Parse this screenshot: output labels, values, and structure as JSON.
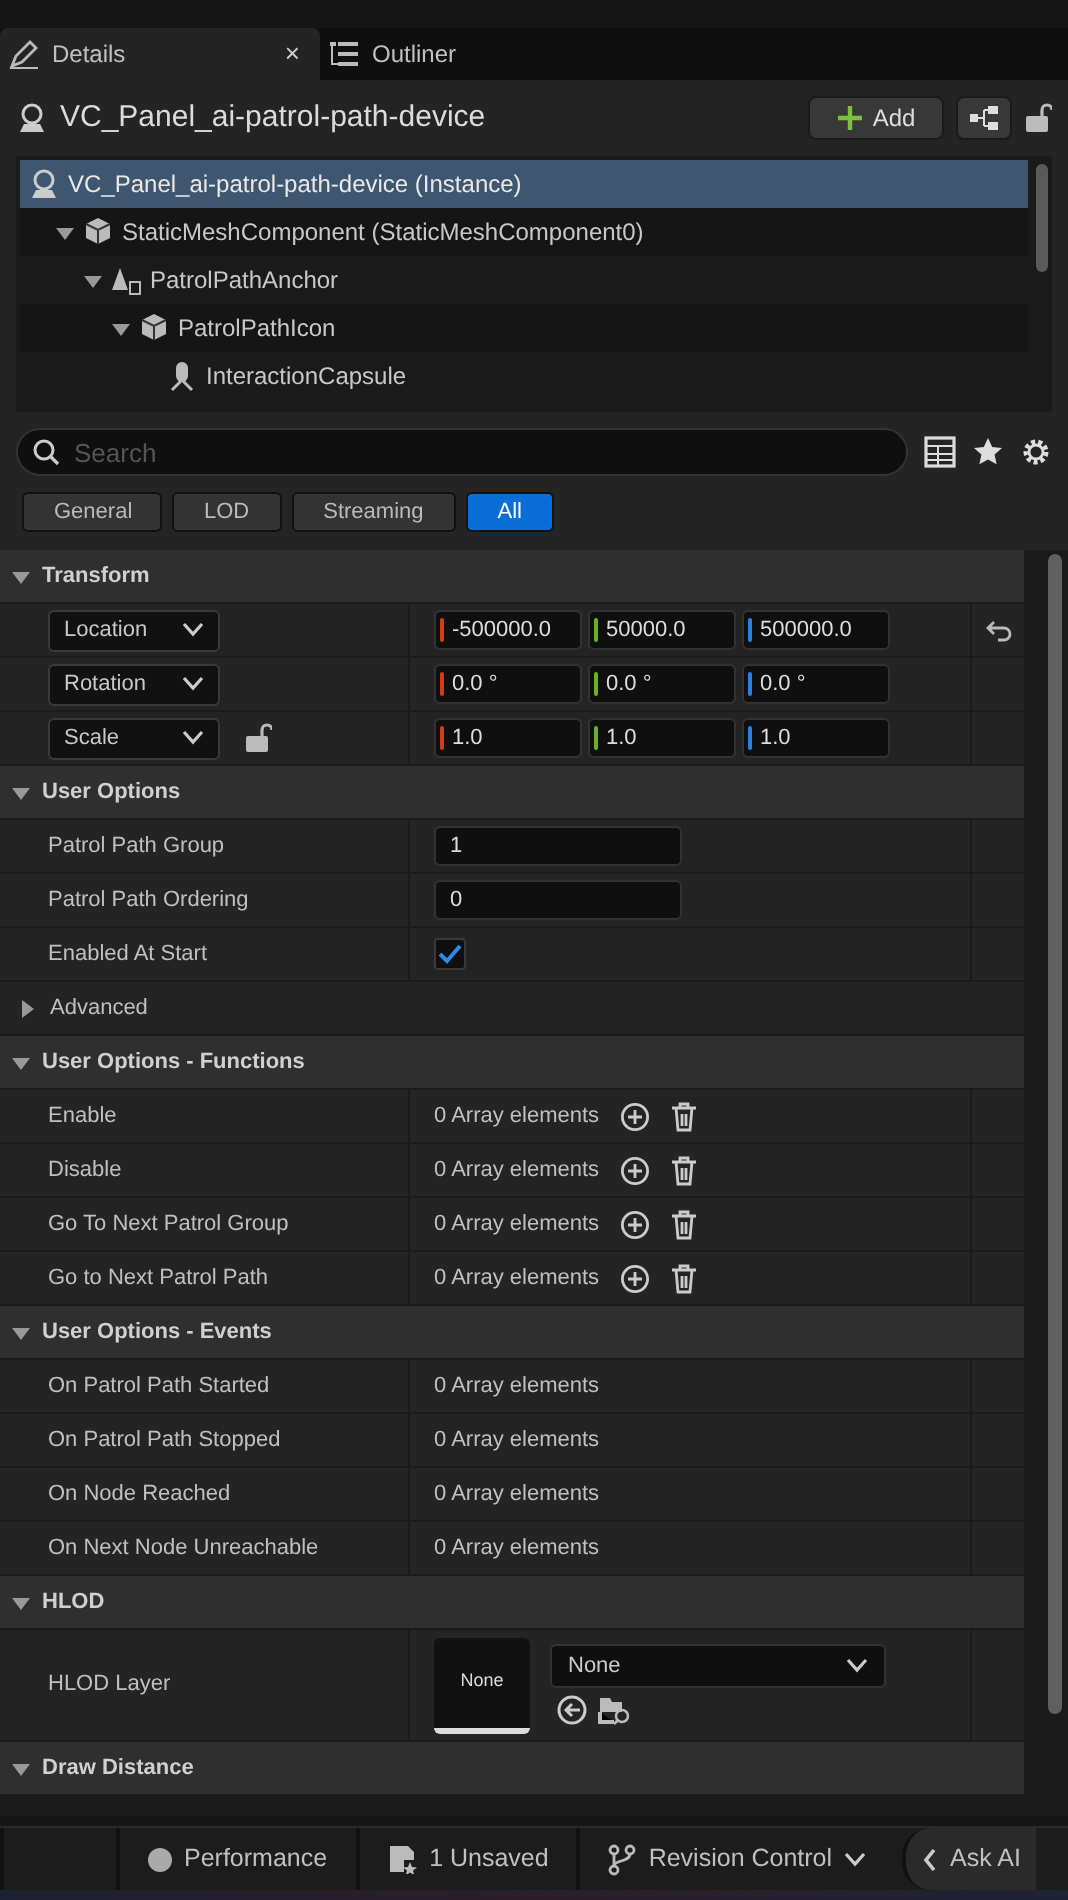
{
  "tabs": [
    {
      "label": "Details",
      "selected": true,
      "close": "×"
    },
    {
      "label": "Outliner",
      "selected": false
    }
  ],
  "header": {
    "title": "VC_Panel_ai-patrol-path-device",
    "add_button": "Add"
  },
  "tree": [
    {
      "label": "VC_Panel_ai-patrol-path-device (Instance)",
      "kind": "actor",
      "selected": true,
      "children": [
        {
          "label": "StaticMeshComponent (StaticMeshComponent0)",
          "kind": "mesh",
          "selected": false,
          "expanded": true,
          "children": [
            {
              "label": "PatrolPathAnchor",
              "kind": "anchor",
              "selected": false,
              "expanded": true,
              "children": [
                {
                  "label": "PatrolPathIcon",
                  "kind": "mesh",
                  "selected": false,
                  "expanded": true,
                  "children": [
                    {
                      "label": "InteractionCapsule",
                      "kind": "capsule",
                      "selected": false
                    }
                  ]
                }
              ]
            }
          ]
        }
      ]
    }
  ],
  "search": {
    "placeholder": "Search"
  },
  "filters": [
    {
      "label": "General",
      "selected": false
    },
    {
      "label": "LOD",
      "selected": false
    },
    {
      "label": "Streaming",
      "selected": false
    },
    {
      "label": "All",
      "selected": true
    }
  ],
  "sections": [
    {
      "title": "Transform",
      "expanded": true,
      "rows": [
        {
          "kind": "vector",
          "label": "Location",
          "values": [
            "-500000.0",
            "50000.0",
            "500000.0"
          ],
          "reset": true,
          "lockable": false
        },
        {
          "kind": "vector",
          "label": "Rotation",
          "values": [
            "0.0 °",
            "0.0 °",
            "0.0 °"
          ],
          "reset": false,
          "lockable": false
        },
        {
          "kind": "vector",
          "label": "Scale",
          "values": [
            "1.0",
            "1.0",
            "1.0"
          ],
          "reset": false,
          "lockable": true
        }
      ]
    },
    {
      "title": "User Options",
      "expanded": true,
      "rows": [
        {
          "kind": "number",
          "label": "Patrol Path Group",
          "value": "1"
        },
        {
          "kind": "number",
          "label": "Patrol Path Ordering",
          "value": "0"
        },
        {
          "kind": "checkbox",
          "label": "Enabled At Start",
          "checked": true
        },
        {
          "kind": "group",
          "label": "Advanced",
          "expanded": false
        }
      ]
    },
    {
      "title": "User Options - Functions",
      "expanded": true,
      "rows": [
        {
          "kind": "array",
          "label": "Enable",
          "value": "0 Array elements",
          "editable": true
        },
        {
          "kind": "array",
          "label": "Disable",
          "value": "0 Array elements",
          "editable": true
        },
        {
          "kind": "array",
          "label": "Go To Next Patrol Group",
          "value": "0 Array elements",
          "editable": true
        },
        {
          "kind": "array",
          "label": "Go to Next Patrol Path",
          "value": "0 Array elements",
          "editable": true
        }
      ]
    },
    {
      "title": "User Options - Events",
      "expanded": true,
      "rows": [
        {
          "kind": "array",
          "label": "On Patrol Path Started",
          "value": "0 Array elements",
          "editable": false
        },
        {
          "kind": "array",
          "label": "On Patrol Path Stopped",
          "value": "0 Array elements",
          "editable": false
        },
        {
          "kind": "array",
          "label": "On Node Reached",
          "value": "0 Array elements",
          "editable": false
        },
        {
          "kind": "array",
          "label": "On Next Node Unreachable",
          "value": "0 Array elements",
          "editable": false
        }
      ]
    },
    {
      "title": "HLOD",
      "expanded": true,
      "rows": [
        {
          "kind": "asset",
          "label": "HLOD Layer",
          "thumbnail": "None",
          "value": "None"
        }
      ]
    },
    {
      "title": "Draw Distance",
      "expanded": true
    }
  ],
  "status_bar": [
    {
      "kind": "performance",
      "label": "Performance"
    },
    {
      "kind": "unsaved",
      "label": "1 Unsaved"
    },
    {
      "kind": "revision",
      "label": "Revision Control"
    },
    {
      "kind": "ai",
      "label": "Ask AI"
    }
  ]
}
